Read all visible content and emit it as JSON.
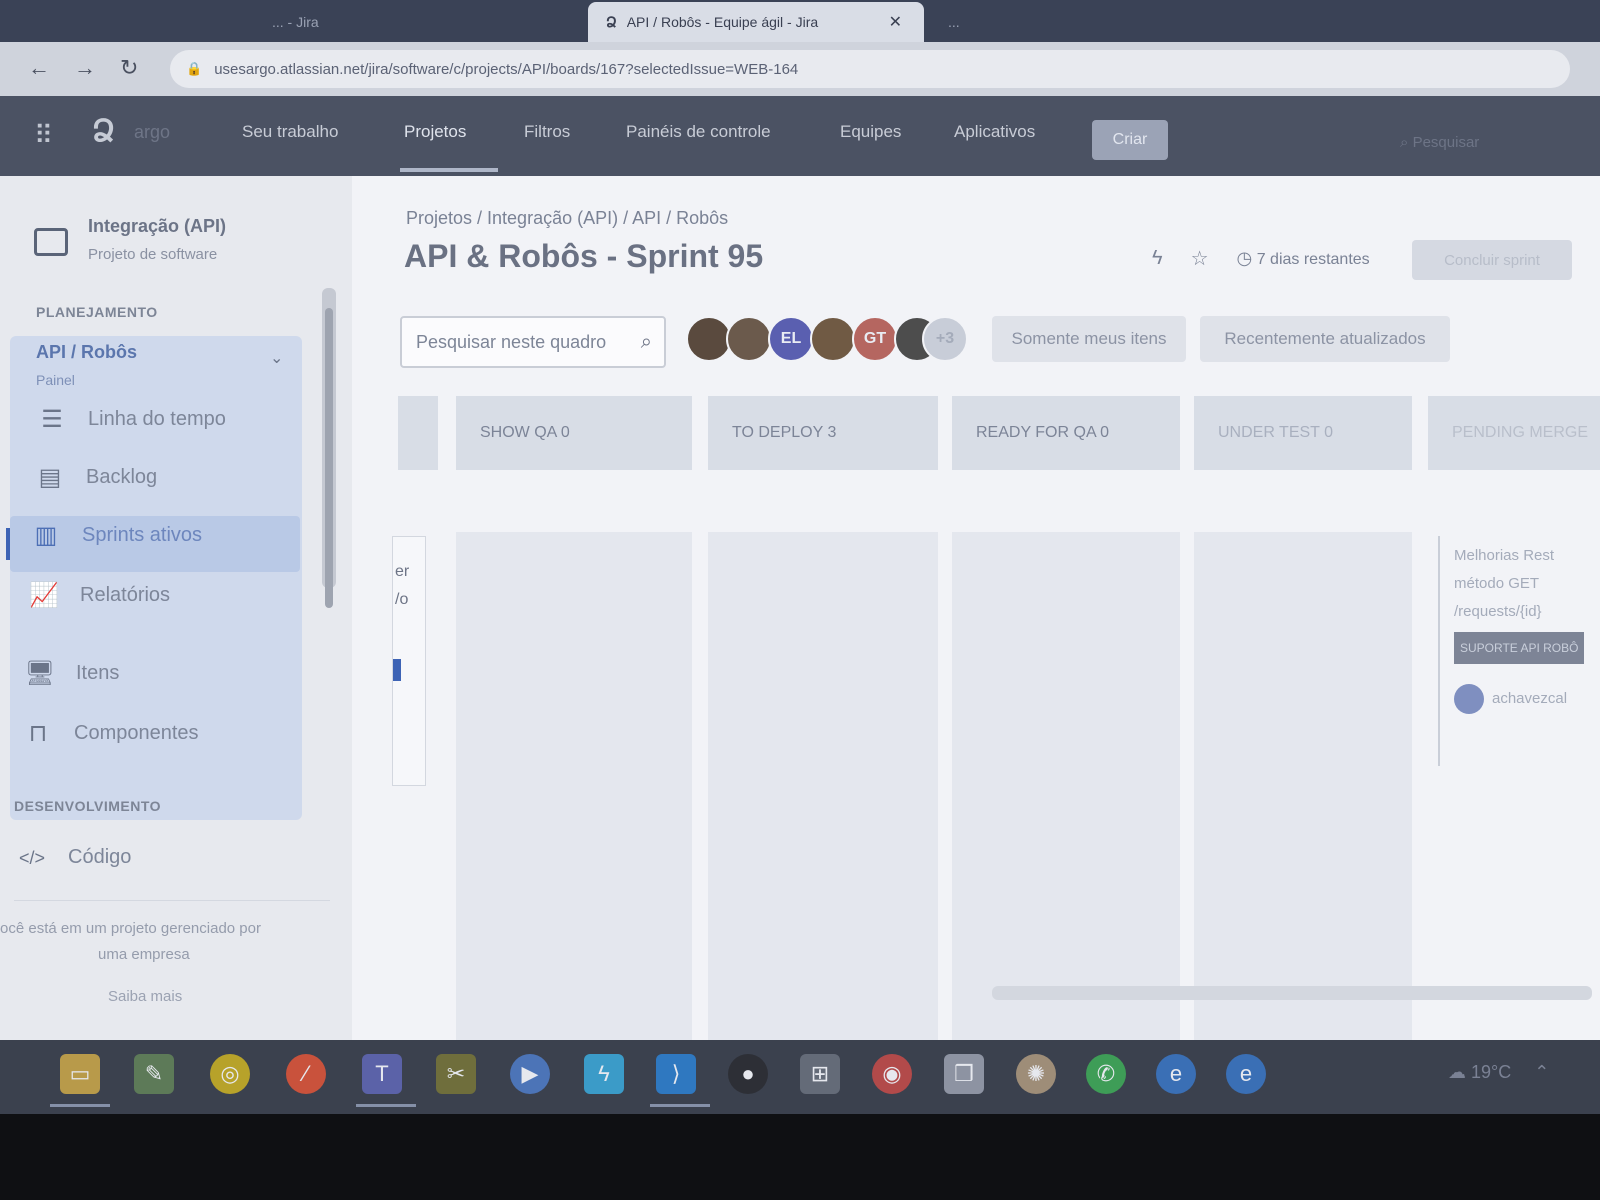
{
  "browser": {
    "inactive_tab_left": "... - Jira",
    "active_tab_title": "API / Robôs - Equipe ágil - Jira",
    "inactive_tab_right": "...",
    "url": "usesargo.atlassian.net/jira/software/c/projects/API/boards/167?selectedIssue=WEB-164"
  },
  "topnav": {
    "logo_text": "argo",
    "items": [
      "Seu trabalho",
      "Projetos",
      "Filtros",
      "Painéis de controle",
      "Equipes",
      "Aplicativos"
    ],
    "create_label": "Criar",
    "search_placeholder": "Pesquisar"
  },
  "sidebar": {
    "project_name": "Integração (API)",
    "project_type": "Projeto de software",
    "planning_heading": "PLANEJAMENTO",
    "board_name": "API / Robôs",
    "board_type": "Painel",
    "planning_items": [
      "Linha do tempo",
      "Backlog",
      "Sprints ativos",
      "Relatórios"
    ],
    "other_items": [
      "Itens",
      "Componentes"
    ],
    "dev_heading": "DESENVOLVIMENTO",
    "dev_items": [
      "Código"
    ],
    "managed_note_1": "ocê está em um projeto gerenciado por",
    "managed_note_2": "uma empresa",
    "learn_more": "Saiba mais"
  },
  "main": {
    "breadcrumb": "Projetos  /  Integração (API)  /  API / Robôs",
    "title": "API & Robôs - Sprint 95",
    "days_remaining": "7 dias restantes",
    "complete_sprint": "Concluir sprint",
    "search_placeholder": "Pesquisar neste quadro",
    "avatars": [
      {
        "initials": "",
        "color": "#5a4a3e"
      },
      {
        "initials": "",
        "color": "#6b5a4c"
      },
      {
        "initials": "EL",
        "color": "#5a5fb0"
      },
      {
        "initials": "",
        "color": "#705a44"
      },
      {
        "initials": "GT",
        "color": "#b56660"
      },
      {
        "initials": "",
        "color": "#4d4d4d"
      },
      {
        "initials": "+3",
        "color": "#c8cdd8"
      }
    ],
    "filter_only_mine": "Somente meus itens",
    "filter_recent": "Recentemente atualizados",
    "columns": [
      "SHOW QA  0",
      "TO DEPLOY  3",
      "READY FOR QA  0",
      "UNDER TEST  0",
      "PENDING MERGE"
    ],
    "partial_card_lines": [
      "er",
      "/o"
    ],
    "right_card_lines": [
      "Melhorias Rest",
      "método GET",
      "/requests/{id}"
    ],
    "right_card_tag": "SUPORTE API ROBÔ",
    "right_card_user": "achavezcal"
  },
  "taskbar": {
    "weather": "19°C"
  },
  "colors": {
    "accent": "#3d63b5",
    "nav_bg": "#4b5263",
    "sidebar_active": "#b9c9e6"
  }
}
